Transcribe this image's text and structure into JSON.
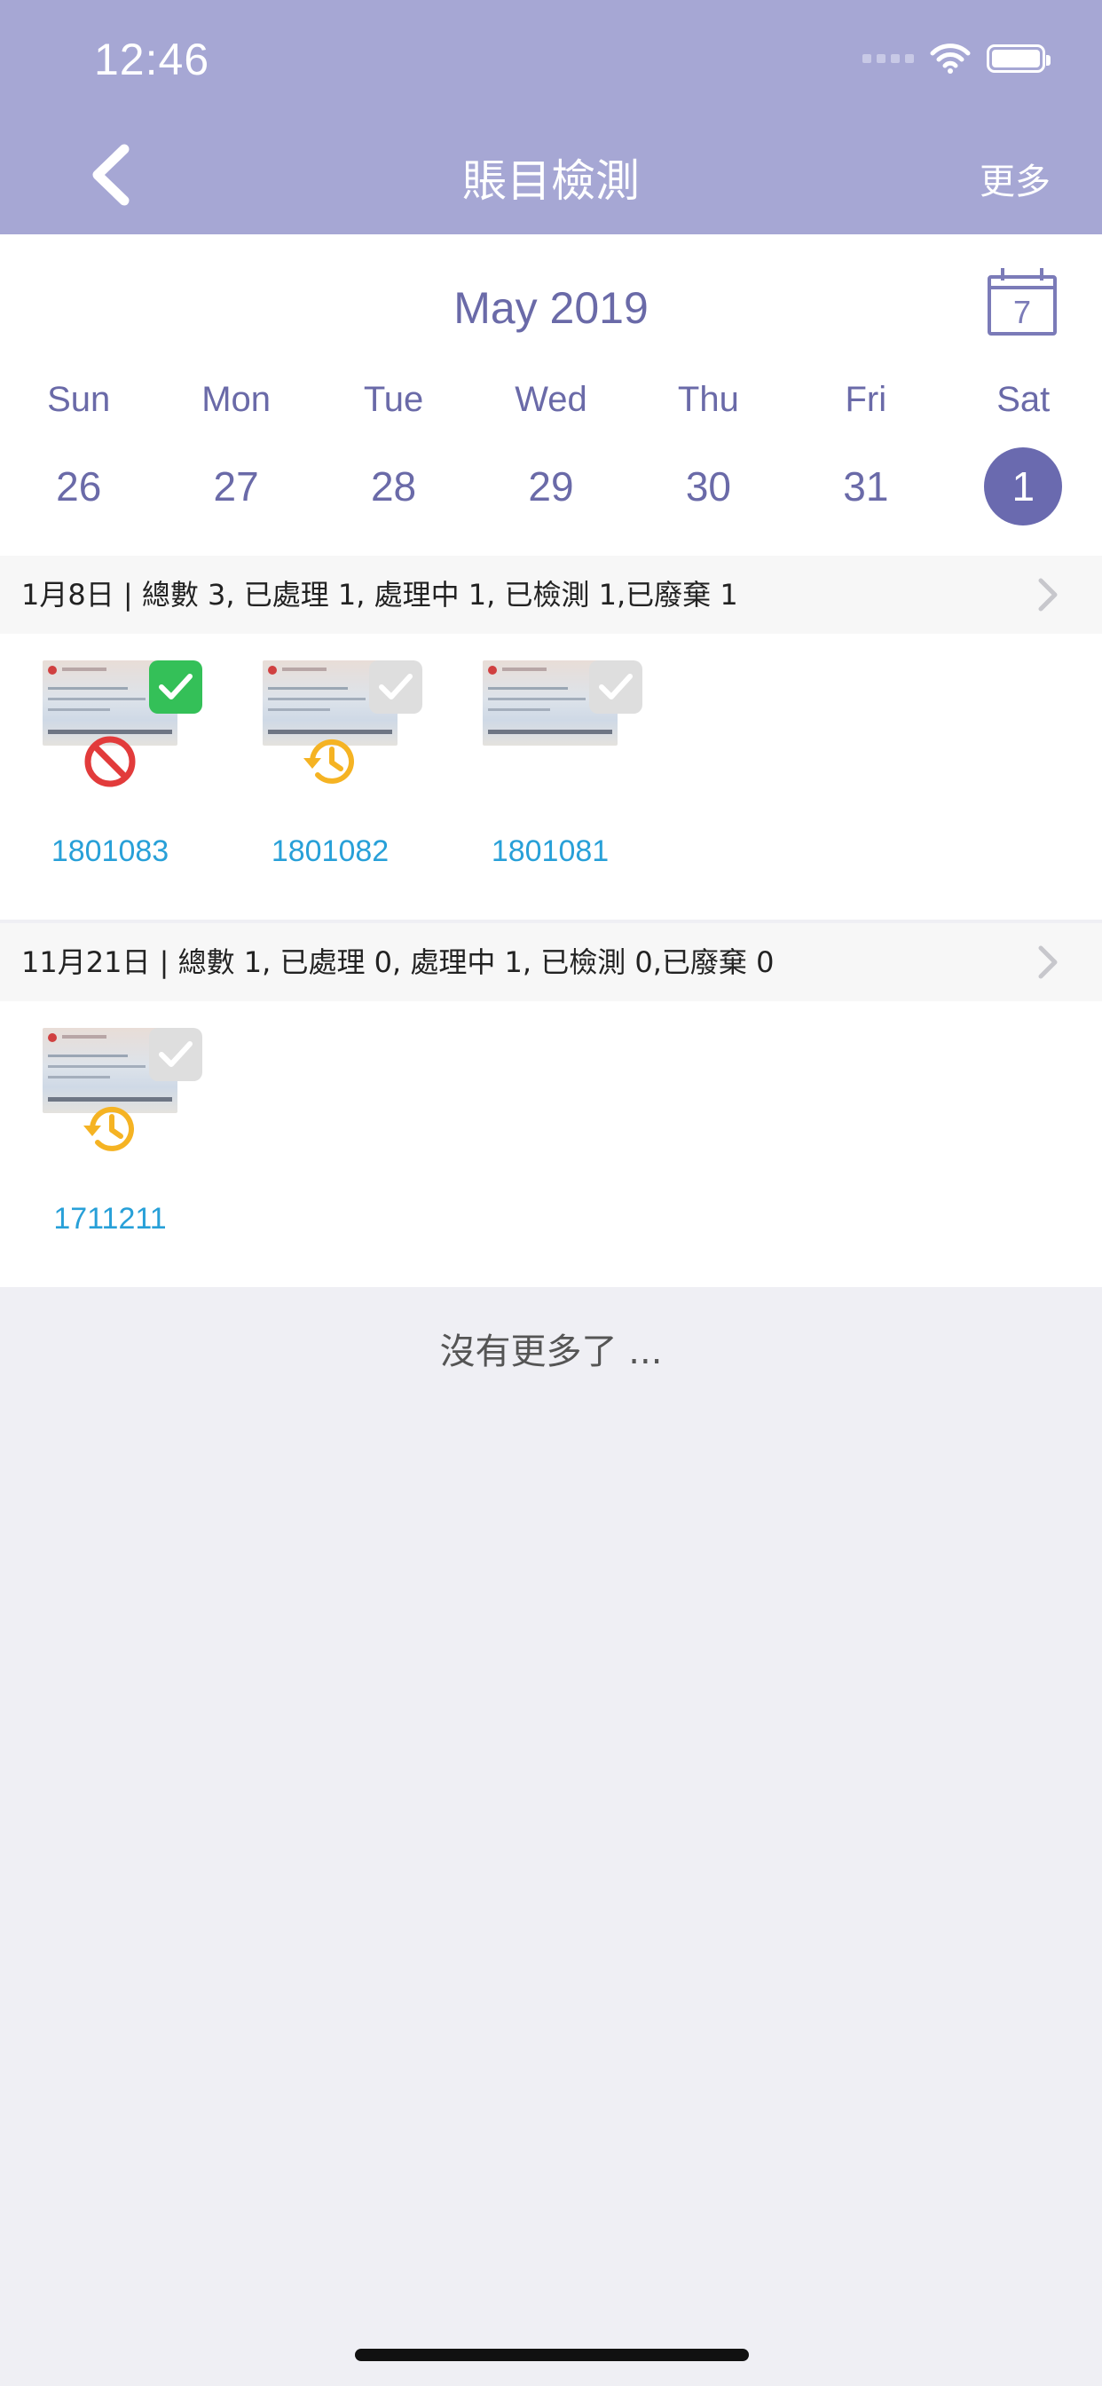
{
  "status_bar": {
    "time": "12:46"
  },
  "nav": {
    "title": "賬目檢測",
    "more_label": "更多"
  },
  "calendar": {
    "month_label": "May 2019",
    "icon_day": "7",
    "weekdays": [
      "Sun",
      "Mon",
      "Tue",
      "Wed",
      "Thu",
      "Fri",
      "Sat"
    ],
    "dates": [
      "26",
      "27",
      "28",
      "29",
      "30",
      "31",
      "1"
    ],
    "selected_index": 6
  },
  "sections": [
    {
      "header": "1月8日 | 總數 3, 已處理 1, 處理中 1, 已檢測 1,已廢棄 1",
      "items": [
        {
          "code": "1801083",
          "checked": true,
          "status_icon": "prohibited-icon"
        },
        {
          "code": "1801082",
          "checked": false,
          "status_icon": "history-icon"
        },
        {
          "code": "1801081",
          "checked": false,
          "status_icon": "none"
        }
      ]
    },
    {
      "header": "11月21日 | 總數 1, 已處理 0, 處理中 1, 已檢測 0,已廢棄 0",
      "items": [
        {
          "code": "1711211",
          "checked": false,
          "status_icon": "history-icon"
        }
      ]
    }
  ],
  "footer": {
    "no_more_text": "沒有更多了 ..."
  },
  "colors": {
    "nav_bg": "#a6a7d4",
    "accent": "#6a6aaf",
    "link": "#28a0d8",
    "check_on": "#34c058",
    "prohibited": "#e23b3b",
    "history": "#f5b323"
  }
}
